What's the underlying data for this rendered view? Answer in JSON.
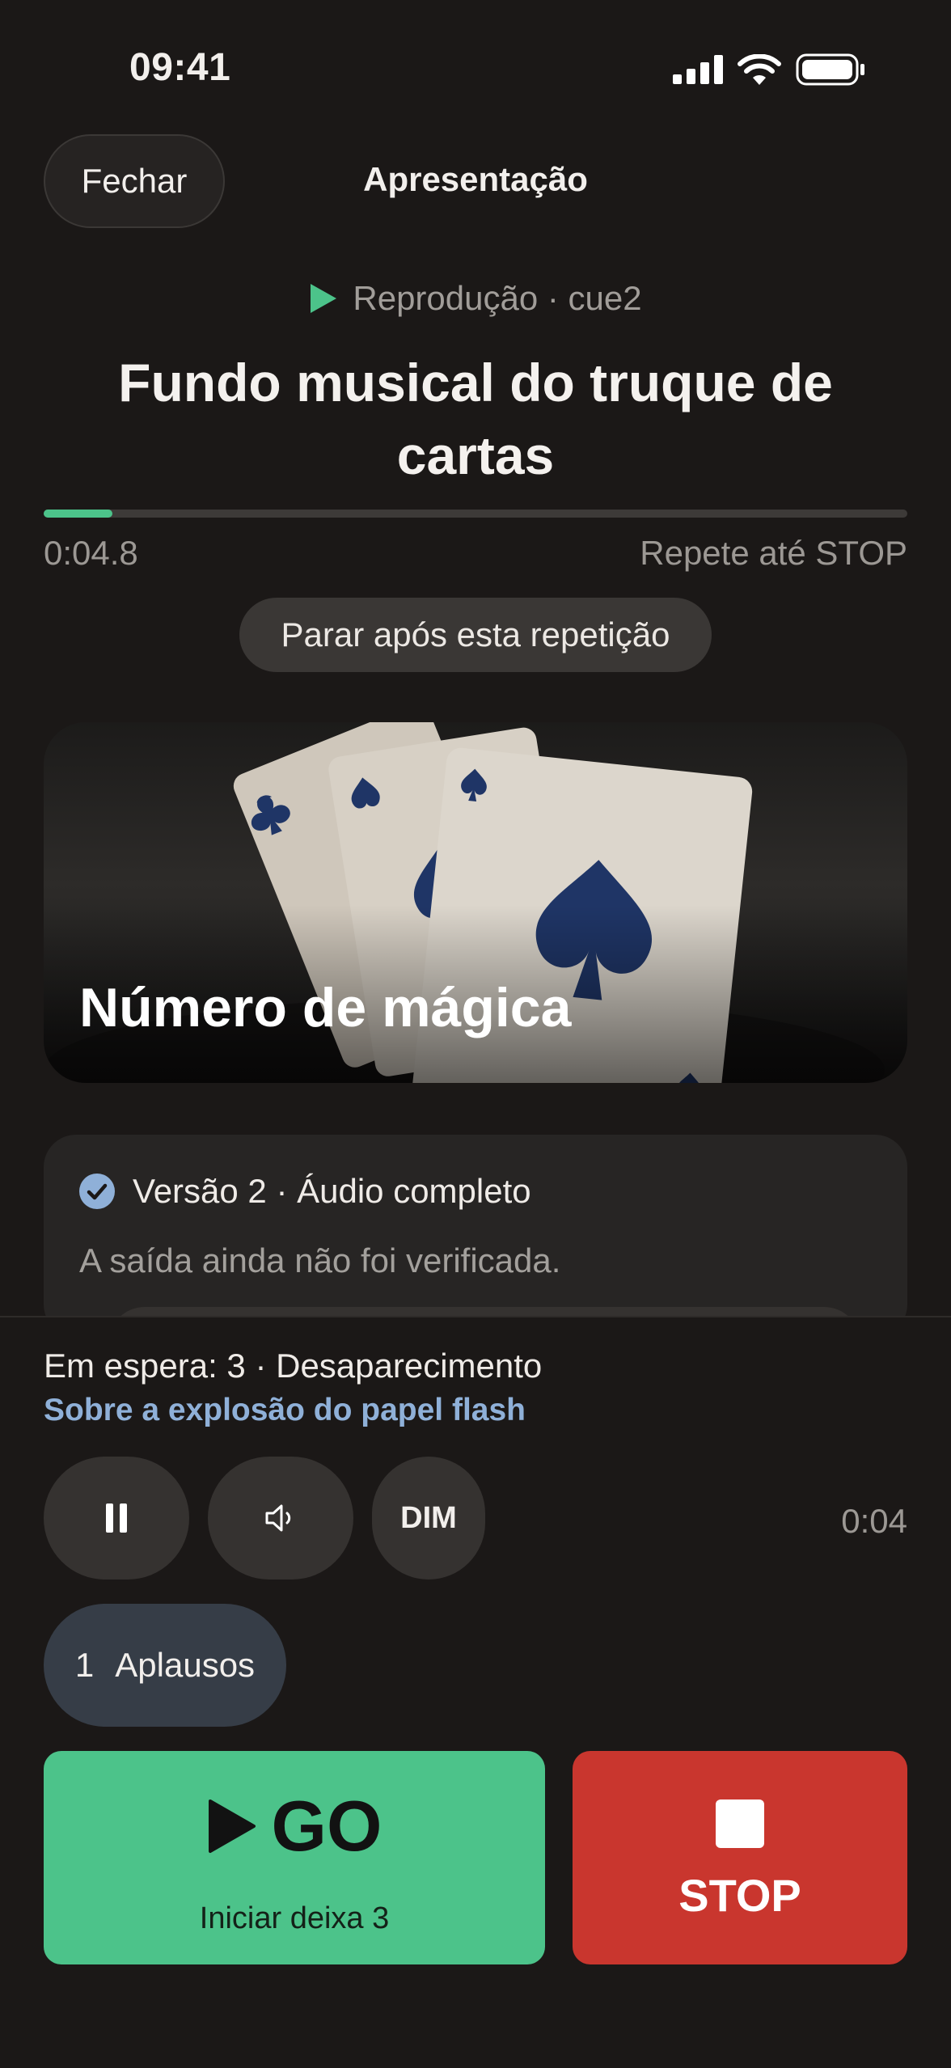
{
  "status_bar": {
    "time": "09:41"
  },
  "header": {
    "close_label": "Fechar",
    "title": "Apresentação"
  },
  "now_playing": {
    "state_label": "Reprodução · cue2",
    "title": "Fundo musical do truque de cartas",
    "progress_fraction": 0.08,
    "elapsed": "0:04.8",
    "loop_info": "Repete até STOP",
    "stop_after_label": "Parar após esta repetição"
  },
  "image_card": {
    "title": "Número de mágica"
  },
  "version_card": {
    "label": "Versão 2 · Áudio completo",
    "note": "A saída ainda não foi verificada."
  },
  "next_cue": {
    "line": "Em espera: 3 · Desaparecimento",
    "subtitle": "Sobre a explosão do papel flash"
  },
  "controls": {
    "pause_icon": "pause-icon",
    "volume_icon": "volume-icon",
    "dim_label": "DIM",
    "clock": "0:04"
  },
  "preset": {
    "number": "1",
    "label": "Aplausos"
  },
  "go_button": {
    "label": "GO",
    "sublabel": "Iniciar deixa 3"
  },
  "stop_button": {
    "label": "STOP"
  },
  "colors": {
    "accent_green": "#4cc38a",
    "stop_red": "#c9362e",
    "link_blue": "#8fb0d8",
    "background": "#1b1817"
  }
}
